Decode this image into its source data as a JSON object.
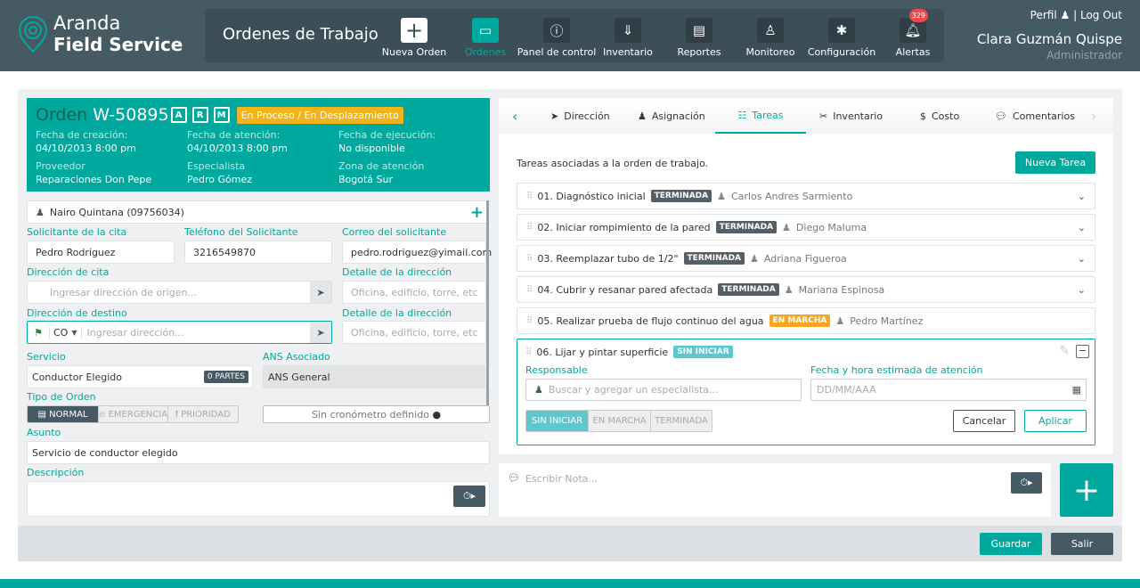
{
  "header": {
    "brand_line1": "Aranda",
    "brand_line2": "Field Service",
    "section_title": "Ordenes de Trabajo",
    "nav": [
      {
        "label": "Nueva Orden",
        "icon": "plus-icon"
      },
      {
        "label": "Ordenes",
        "icon": "window-icon"
      },
      {
        "label": "Panel de control",
        "icon": "dashboard-icon"
      },
      {
        "label": "Inventario",
        "icon": "cart-icon"
      },
      {
        "label": "Reportes",
        "icon": "report-icon"
      },
      {
        "label": "Monitoreo",
        "icon": "person-pin-icon"
      },
      {
        "label": "Configuración",
        "icon": "gear-icon"
      },
      {
        "label": "Alertas",
        "icon": "bell-icon",
        "badge": "329"
      }
    ],
    "profile": "Perfil",
    "logout": "| Log Out",
    "user_name": "Clara Guzmán Quispe",
    "user_role": "Administrador"
  },
  "order": {
    "label": "Orden",
    "id": "W-50895",
    "flags": [
      "A",
      "R",
      "M"
    ],
    "status": "En Proceso / En Desplazamiento",
    "fields": [
      {
        "label": "Fecha de creación:",
        "value": "04/10/2013 8:00 pm"
      },
      {
        "label": "Fecha de atención:",
        "value": "04/10/2013 8:00 pm"
      },
      {
        "label": "Fecha de ejecución:",
        "value": "No disponible"
      },
      {
        "label": "Proveedor",
        "value": "Reparaciones Don Pepe"
      },
      {
        "label": "Especialista",
        "value": "Pedro Gómez"
      },
      {
        "label": "Zona de atención",
        "value": "Bogotá Sur"
      }
    ]
  },
  "form": {
    "client": "Nairo Quintana (09756034)",
    "solicitante_label": "Solicitante de la cita",
    "solicitante": "Pedro Rodríguez",
    "telefono_label": "Teléfono del Solicitante",
    "telefono": "3216549870",
    "correo_label": "Correo del solicitante",
    "correo": "pedro.rodriguez@yimail.com",
    "dir_cita_label": "Dirección de cita",
    "dir_cita_ph": "Ingresar dirección de origen...",
    "detalle_label": "Detalle de la dirección",
    "detalle_ph": "Oficina, edificio, torre, etc",
    "dir_dest_label": "Dirección de destino",
    "country": "CO",
    "dir_dest_ph": "Ingresar dirección...",
    "servicio_label": "Servicio",
    "servicio": "Conductor Elegido",
    "partes": "0 PARTES",
    "ans_label": "ANS Asociado",
    "ans": "ANS General",
    "tipo_label": "Tipo de Orden",
    "tipos": [
      "NORMAL",
      "EMERGENCIA",
      "PRIORIDAD"
    ],
    "cronometro": "Sin cronómetro definido",
    "asunto_label": "Asunto",
    "asunto": "Servicio de conductor elegido",
    "desc_label": "Descripción"
  },
  "tabs": [
    {
      "label": "Dirección"
    },
    {
      "label": "Asignación"
    },
    {
      "label": "Tareas"
    },
    {
      "label": "Inventario"
    },
    {
      "label": "Costo"
    },
    {
      "label": "Comentarios"
    }
  ],
  "tasks_intro": "Tareas asociadas a la orden de trabajo.",
  "new_task": "Nueva Tarea",
  "tasks": [
    {
      "name": "01. Diagnóstico inicial",
      "status": "TERMINADA",
      "person": "Carlos Andres Sarmiento"
    },
    {
      "name": "02. Iniciar rompimiento de la pared",
      "status": "TERMINADA",
      "person": "Diego Maluma"
    },
    {
      "name": "03. Reemplazar tubo de 1/2\"",
      "status": "TERMINADA",
      "person": "Adriana Figueroa"
    },
    {
      "name": "04. Cubrir y resanar pared afectada",
      "status": "TERMINADA",
      "person": "Mariana Espinosa"
    },
    {
      "name": "05. Realizar prueba de flujo continuo del agua",
      "status": "EN MARCHA",
      "person": "Pedro Martínez"
    }
  ],
  "edit_task": {
    "name": "06. Lijar y pintar superficie",
    "status": "SIN INICIAR",
    "resp_label": "Responsable",
    "resp_ph": "Buscar y agregar un especialista...",
    "date_label": "Fecha y hora estimada de atención",
    "date_ph": "DD/MM/AAA",
    "states": [
      "SIN INICIAR",
      "EN MARCHA",
      "TERMINADA"
    ],
    "cancel": "Cancelar",
    "apply": "Aplicar"
  },
  "note_ph": "Escribir Nota...",
  "save": "Guardar",
  "exit": "Salir",
  "colors": {
    "teal": "#00a99d",
    "header": "#465a64",
    "terminada": "#555f66",
    "en_marcha": "#f5a623",
    "sin_iniciar": "#5bc8cf",
    "status": "#f2b41b"
  }
}
